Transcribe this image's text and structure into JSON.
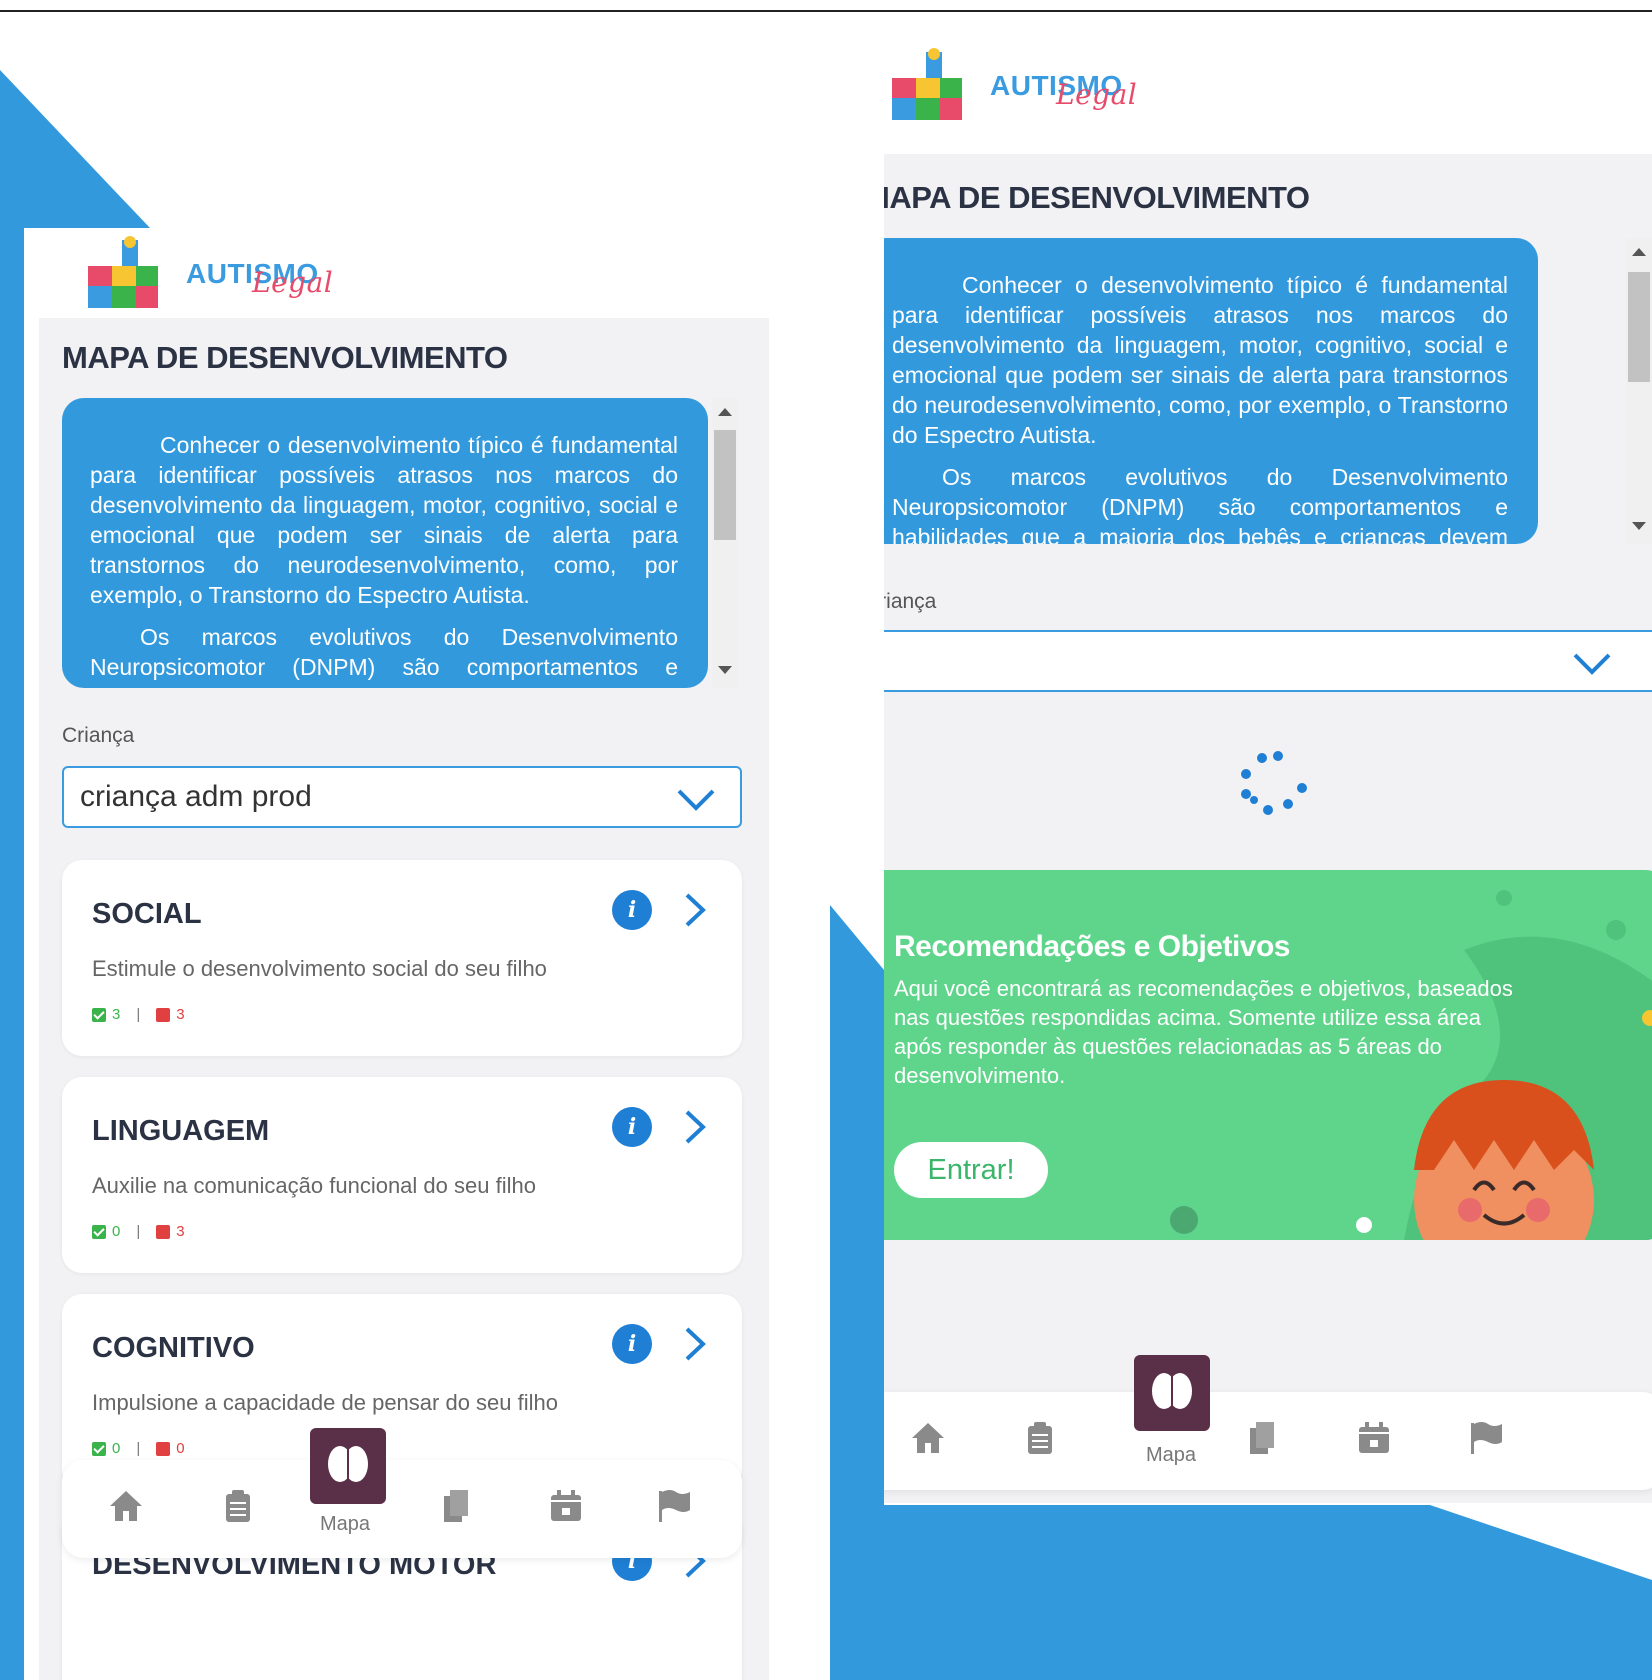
{
  "brand": {
    "name_main": "AUTISMO",
    "name_script": "Legal"
  },
  "colors": {
    "primary": "#3399dd",
    "accent_nav": "#5a2f48",
    "card_green": "#5fd58c",
    "ok": "#3ab34a",
    "bad": "#e04040"
  },
  "left_screen": {
    "page_title": "MAPA DE DESENVOLVIMENTO",
    "intro_p1": "Conhecer o desenvolvimento típico é fundamental para identificar possíveis atrasos nos marcos do desenvolvimento da linguagem, motor, cognitivo, social e emocional que podem ser sinais de alerta para transtornos do neurodesenvolvimento, como, por exemplo, o Transtorno do Espectro Autista.",
    "intro_p2": "Os marcos evolutivos do Desenvolvimento Neuropsicomotor (DNPM) são comportamentos e habilidades que a maioria dos bebês e crianças devem alcançar dentro de",
    "child_label": "Criança",
    "child_value": "criança adm prod",
    "cards": [
      {
        "title": "SOCIAL",
        "desc": "Estimule o desenvolvimento social do seu filho",
        "ok": "3",
        "bad": "3"
      },
      {
        "title": "LINGUAGEM",
        "desc": "Auxilie na comunicação funcional do seu filho",
        "ok": "0",
        "bad": "3"
      },
      {
        "title": "COGNITIVO",
        "desc": "Impulsione a capacidade de pensar do seu filho",
        "ok": "0",
        "bad": "0"
      },
      {
        "title": "DESENVOLVIMENTO MOTOR",
        "desc": "",
        "ok": "",
        "bad": ""
      }
    ],
    "stats_sep": "|",
    "info_glyph": "i",
    "nav": {
      "active_label": "Mapa",
      "icons": [
        "home-icon",
        "clipboard-icon",
        "brain-icon",
        "documents-icon",
        "calendar-icon",
        "flag-icon"
      ]
    }
  },
  "right_screen": {
    "page_title": "MAPA DE DESENVOLVIMENTO",
    "intro_p1": "Conhecer o desenvolvimento típico é fundamental para identificar possíveis atrasos nos marcos do desenvolvimento da linguagem, motor, cognitivo, social e emocional que podem ser sinais de alerta para transtornos do neurodesenvolvimento, como, por exemplo, o Transtorno do Espectro Autista.",
    "intro_p2": "Os marcos evolutivos do Desenvolvimento Neuropsicomotor (DNPM) são comportamentos e habilidades que a maioria dos bebês e crianças devem alcançar dentro de",
    "child_label": "Criança",
    "child_value": "",
    "reco": {
      "title": "Recomendações e Objetivos",
      "text": "Aqui você encontrará as recomendações e objetivos, baseados nas questões respondidas acima. Somente utilize essa área após responder às questões relacionadas as 5 áreas do desenvolvimento.",
      "button": "Entrar!"
    },
    "nav": {
      "active_label": "Mapa"
    }
  }
}
